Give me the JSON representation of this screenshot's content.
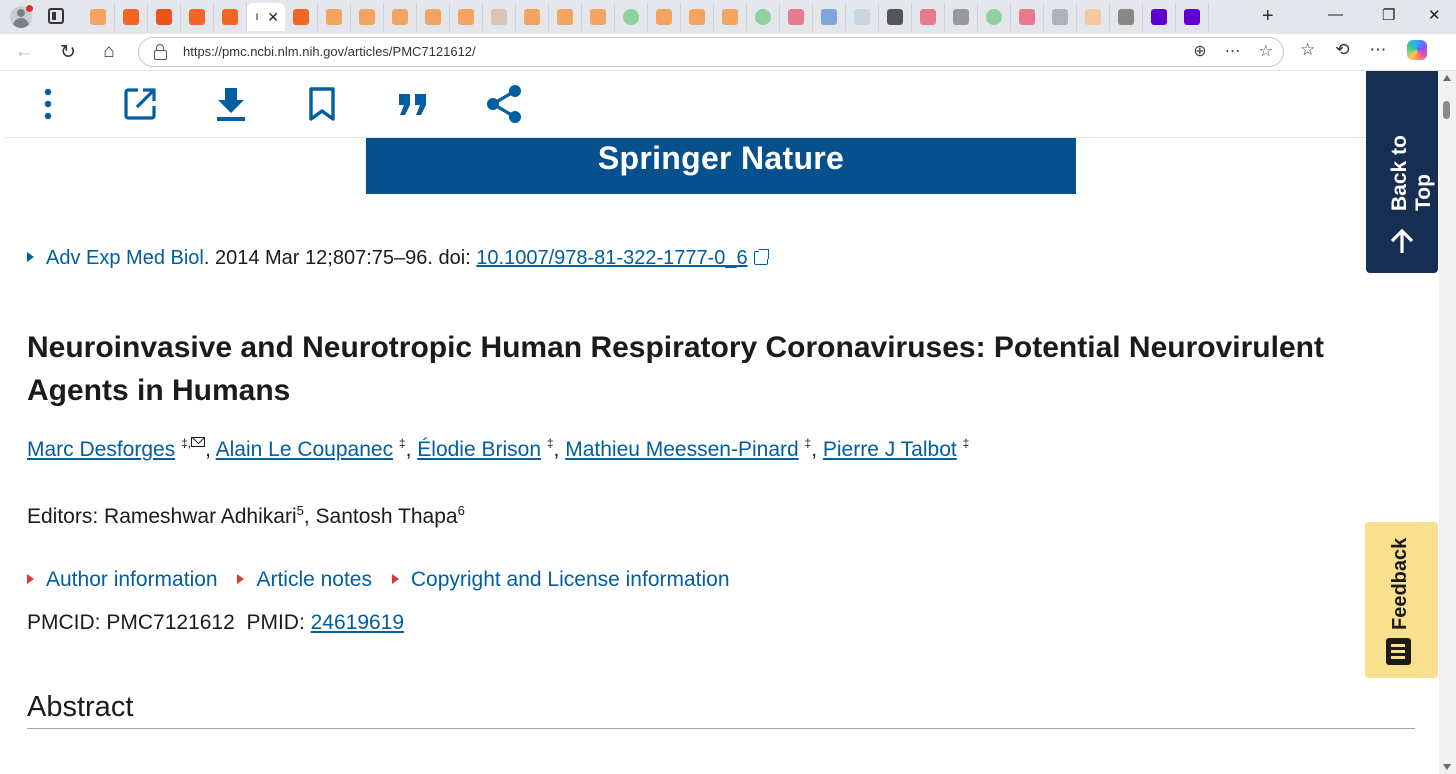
{
  "browser": {
    "url": "https://pmc.ncbi.nlm.nih.gov/articles/PMC7121612/",
    "tab_colors": [
      "#f26522",
      "#f26522",
      "#e8561c",
      "#f26522",
      "#f26522"
    ],
    "active_tab_label": "I"
  },
  "page": {
    "toolbar": {
      "icons": [
        "more-options-icon",
        "open-in-new-icon",
        "download-icon",
        "bookmark-icon",
        "cite-icon",
        "share-icon"
      ]
    },
    "publisher_banner": "Springer Nature",
    "citation": {
      "journal": "Adv Exp Med Biol",
      "details": ". 2014 Mar 12;807:75–96. doi: ",
      "doi": "10.1007/978-81-322-1777-0_6"
    },
    "title": "Neuroinvasive and Neurotropic Human Respiratory Coronaviruses: Potential Neurovirulent Agents in Humans",
    "authors": [
      {
        "name": "Marc Desforges",
        "mark": "‡"
      },
      {
        "name": "Alain Le Coupanec",
        "mark": "‡"
      },
      {
        "name": "Élodie Brison",
        "mark": "‡"
      },
      {
        "name": "Mathieu Meessen-Pinard",
        "mark": "‡"
      },
      {
        "name": "Pierre J Talbot",
        "mark": "‡"
      }
    ],
    "editors": {
      "label": "Editors: ",
      "names": [
        {
          "name": "Rameshwar Adhikari",
          "sup": "5"
        },
        {
          "name": "Santosh Thapa",
          "sup": "6"
        }
      ]
    },
    "accordions": [
      "Author information",
      "Article notes",
      "Copyright and License information"
    ],
    "ids": {
      "pmcid_label": "PMCID: ",
      "pmcid": "PMC7121612",
      "pmid_label": "PMID: ",
      "pmid": "24619619"
    },
    "abstract_heading": "Abstract",
    "back_to_top": "Back to Top",
    "feedback": "Feedback"
  }
}
